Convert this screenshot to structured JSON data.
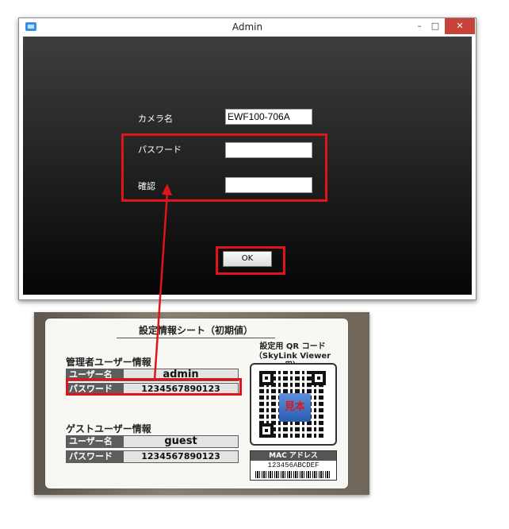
{
  "window": {
    "title": "Admin",
    "controls": {
      "minimize": "–",
      "maximize": "□",
      "close": "✕"
    },
    "colors": {
      "close_button": "#c7433a",
      "highlight": "#e0141b"
    }
  },
  "form": {
    "camera_name_label": "カメラ名",
    "camera_name_value": "EWF100-706A",
    "password_label": "パスワード",
    "password_value": "",
    "confirm_label": "確認",
    "confirm_value": "",
    "ok_label": "OK"
  },
  "sheet": {
    "title": "設定情報シート（初期値）",
    "admin_section": "管理者ユーザー情報",
    "admin_user_label": "ユーザー名",
    "admin_user_value": "admin",
    "admin_pass_label": "パスワード",
    "admin_pass_value": "1234567890123",
    "guest_section": "ゲストユーザー情報",
    "guest_user_label": "ユーザー名",
    "guest_user_value": "guest",
    "guest_pass_label": "パスワード",
    "guest_pass_value": "1234567890123",
    "qr_title_line1": "設定用 QR コード",
    "qr_title_line2": "（SkyLink Viewer 用）",
    "sample_label": "見本",
    "mac_label": "MAC アドレス",
    "mac_value": "123456ABCDEF"
  }
}
